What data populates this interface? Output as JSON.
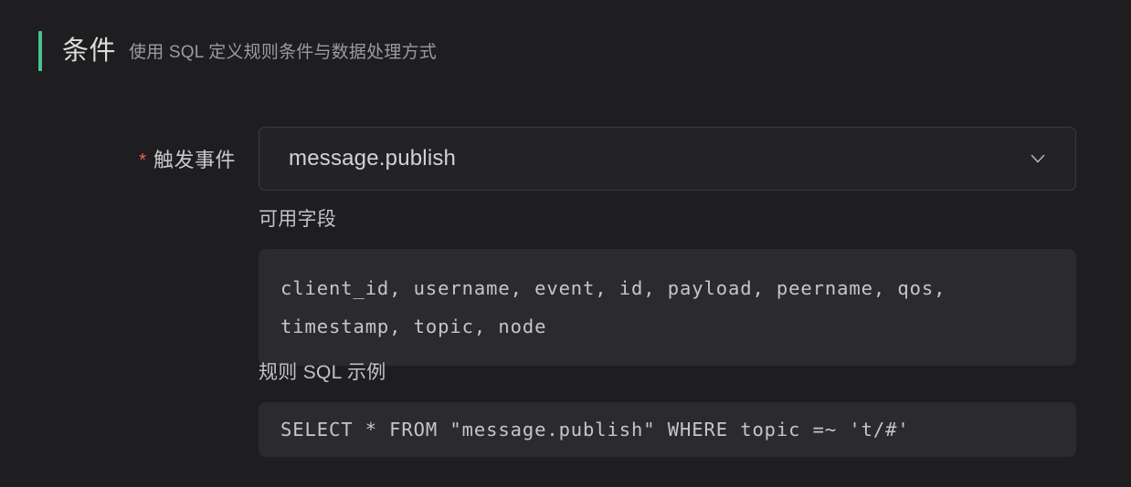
{
  "section": {
    "title": "条件",
    "subtitle": "使用 SQL 定义规则条件与数据处理方式",
    "accent_color": "#4bc28c"
  },
  "form": {
    "required_marker": "*",
    "trigger_event": {
      "label": "触发事件",
      "value": "message.publish",
      "icon": "chevron-down-icon"
    }
  },
  "available_fields": {
    "label": "可用字段",
    "lines": [
      "client_id, username, event, id, payload, peername, qos,",
      "timestamp, topic, node"
    ]
  },
  "sql_example": {
    "label": "规则 SQL 示例",
    "lines": [
      "SELECT * FROM \"message.publish\" WHERE topic =~ 't/#'"
    ]
  },
  "colors": {
    "page_background": "#1e1d1f",
    "code_background": "#2b2a2e",
    "accent_green": "#4bc28c",
    "required_red": "#f05c5c",
    "text_primary": "#d8d8da",
    "text_muted": "#9b9b9d"
  }
}
